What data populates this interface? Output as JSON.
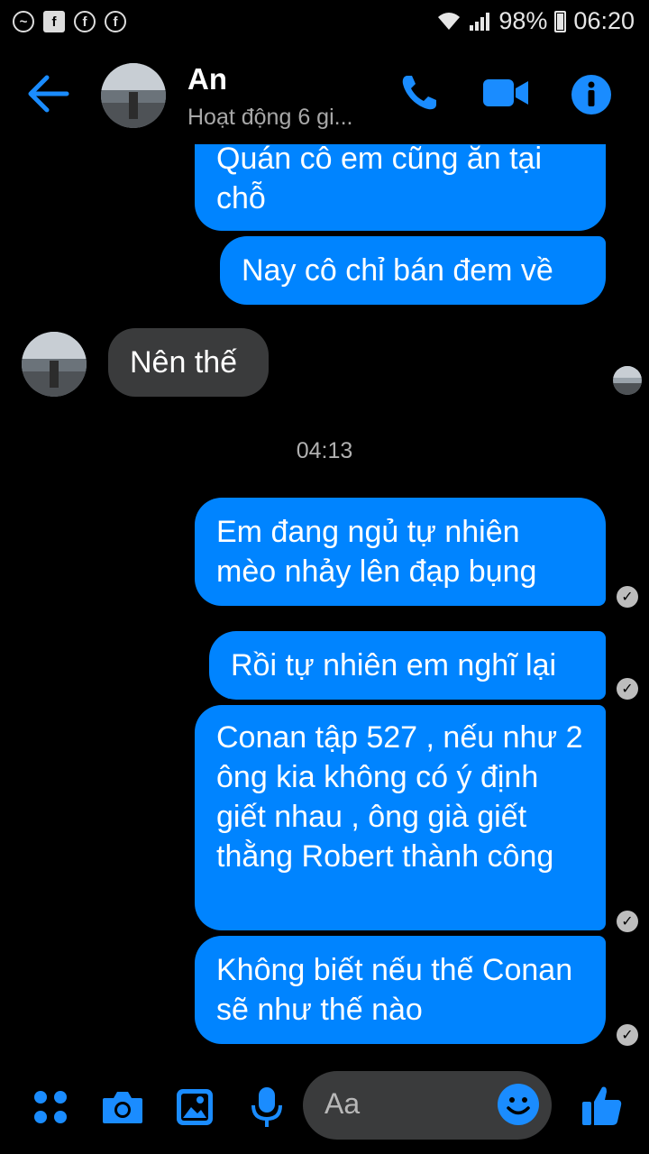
{
  "status_bar": {
    "battery": "98%",
    "time": "06:20"
  },
  "header": {
    "name": "An",
    "status": "Hoạt động 6 gi..."
  },
  "messages": [
    {
      "text": "Quán cô em cũng ăn tại chỗ"
    },
    {
      "text": "Nay cô chỉ bán đem về"
    },
    {
      "text": "Nên thế"
    },
    {
      "text": "04:13"
    },
    {
      "text": "Em đang ngủ tự nhiên mèo nhảy lên đạp bụng"
    },
    {
      "text": "Rồi tự nhiên em nghĩ lại"
    },
    {
      "text": "Conan tập 527 , nếu như 2 ông kia không có ý định giết nhau , ông già giết thằng Robert thành công"
    },
    {
      "text": "Không biết nếu thế Conan sẽ như thế nào"
    }
  ],
  "composer": {
    "placeholder": "Aa"
  },
  "colors": {
    "accent": "#0084ff",
    "incoming": "#3a3b3c",
    "background": "#000000"
  }
}
